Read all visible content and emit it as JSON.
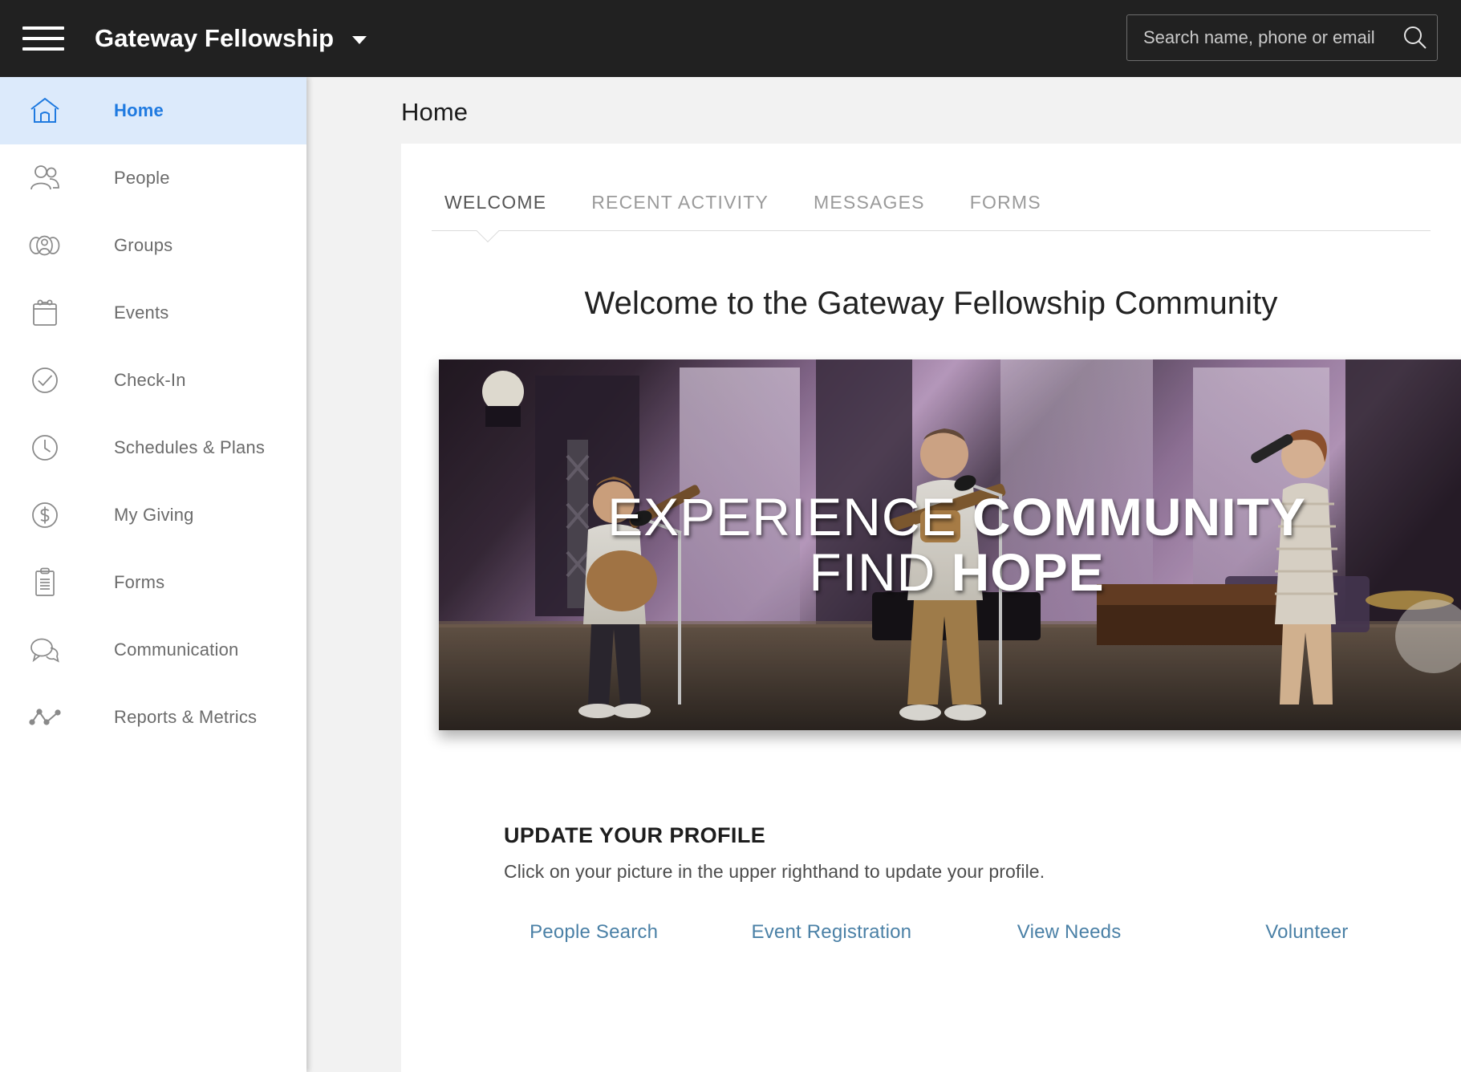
{
  "header": {
    "menu_icon": "hamburger-icon",
    "org_name": "Gateway Fellowship",
    "org_caret": "chevron-down-icon",
    "search": {
      "placeholder": "Search name, phone or email",
      "value": "",
      "icon": "search-icon"
    }
  },
  "sidebar": {
    "items": [
      {
        "label": "Home",
        "icon": "home-icon",
        "active": true
      },
      {
        "label": "People",
        "icon": "people-icon",
        "active": false
      },
      {
        "label": "Groups",
        "icon": "groups-icon",
        "active": false
      },
      {
        "label": "Events",
        "icon": "calendar-icon",
        "active": false
      },
      {
        "label": "Check-In",
        "icon": "check-circle-icon",
        "active": false
      },
      {
        "label": "Schedules & Plans",
        "icon": "clock-icon",
        "active": false
      },
      {
        "label": "My Giving",
        "icon": "dollar-circle-icon",
        "active": false
      },
      {
        "label": "Forms",
        "icon": "clipboard-icon",
        "active": false
      },
      {
        "label": "Communication",
        "icon": "chat-bubbles-icon",
        "active": false
      },
      {
        "label": "Reports & Metrics",
        "icon": "line-chart-icon",
        "active": false
      }
    ]
  },
  "main": {
    "page_title": "Home",
    "tabs": [
      {
        "label": "WELCOME",
        "active": true
      },
      {
        "label": "RECENT ACTIVITY",
        "active": false
      },
      {
        "label": "MESSAGES",
        "active": false
      },
      {
        "label": "FORMS",
        "active": false
      }
    ],
    "welcome_heading": "Welcome to the Gateway Fellowship Community",
    "hero": {
      "line1_thin": "EXPERIENCE ",
      "line1_bold": "COMMUNITY",
      "line2_thin": "FIND ",
      "line2_bold": "HOPE"
    },
    "profile": {
      "title": "UPDATE YOUR PROFILE",
      "description": "Click on your picture in the upper righthand to update your profile."
    },
    "quick_links": [
      "People Search",
      "Event Registration",
      "View Needs",
      "Volunteer"
    ]
  },
  "colors": {
    "topbar_bg": "#212121",
    "accent_blue": "#1f7ae0",
    "active_nav_bg": "#dceafb",
    "link_blue": "#4a80a6",
    "muted_text": "#6b6b6b"
  }
}
